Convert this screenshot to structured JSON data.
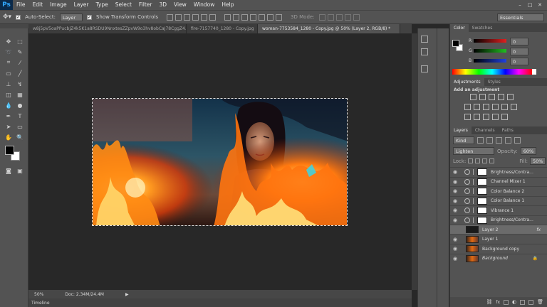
{
  "app": {
    "logo": "Ps"
  },
  "menu": [
    "File",
    "Edit",
    "Image",
    "Layer",
    "Type",
    "Select",
    "Filter",
    "3D",
    "View",
    "Window",
    "Help"
  ],
  "window_buttons": [
    "–",
    "□",
    "✕"
  ],
  "options": {
    "auto_select": "Auto-Select:",
    "auto_select_value": "Layer",
    "show_transform": "Show Transform Controls",
    "mode_3d": "3D Mode:",
    "workspace": "Essentials"
  },
  "tabs": [
    {
      "label": "w8j5pV5oaPPucbJZ4k5K1a8RSDU9NnxtesZZpvW9o3hv8obCaJ78CggZ4.jpg",
      "active": false
    },
    {
      "label": "fire-7157740_1280 - Copy.jpg",
      "active": false
    },
    {
      "label": "woman-7753584_1280 - Copy.jpg @ 50% (Layer 2, RGB/8) *",
      "active": true
    }
  ],
  "status": {
    "zoom": "50%",
    "doc": "Doc: 2.34M/24.4M"
  },
  "timeline": "Timeline",
  "color_panel": {
    "tabs": [
      "Color",
      "Swatches"
    ],
    "channels": [
      {
        "name": "R",
        "value": "0"
      },
      {
        "name": "G",
        "value": "0"
      },
      {
        "name": "B",
        "value": "0"
      }
    ]
  },
  "adjustments": {
    "tabs": [
      "Adjustments",
      "Styles"
    ],
    "title": "Add an adjustment"
  },
  "layers_panel": {
    "tabs": [
      "Layers",
      "Channels",
      "Paths"
    ],
    "kind": "Kind",
    "blend": "Lighten",
    "opacity_label": "Opacity:",
    "opacity": "60%",
    "lock_label": "Lock:",
    "fill_label": "Fill:",
    "fill": "50%",
    "layers": [
      {
        "name": "Brightness/Contra...",
        "type": "adj"
      },
      {
        "name": "Channel Mixer 1",
        "type": "adj"
      },
      {
        "name": "Color Balance 2",
        "type": "adj"
      },
      {
        "name": "Color Balance 1",
        "type": "adj"
      },
      {
        "name": "Vibrance 1",
        "type": "adj"
      },
      {
        "name": "Brightness/Contra...",
        "type": "adj"
      },
      {
        "name": "Layer 2",
        "type": "px",
        "selected": true,
        "fx": "fx"
      },
      {
        "name": "Layer 1",
        "type": "px"
      },
      {
        "name": "Background copy",
        "type": "px"
      },
      {
        "name": "Background",
        "type": "bg"
      }
    ]
  },
  "colors": {
    "accent": "#31a8ff",
    "panel": "#535353",
    "canvas": "#282828"
  }
}
